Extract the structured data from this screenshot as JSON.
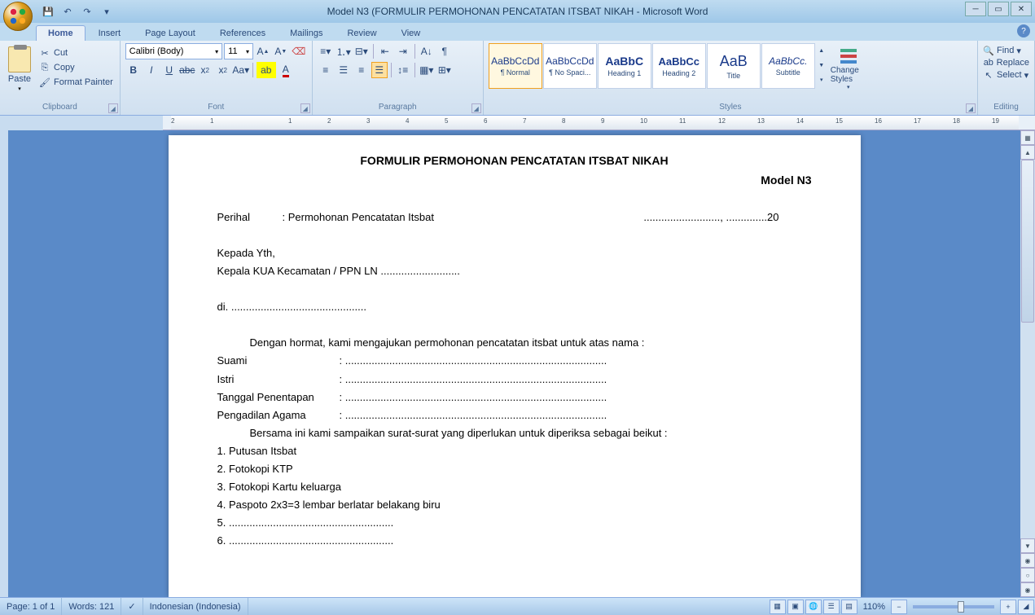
{
  "title": "Model N3 (FORMULIR PERMOHONAN PENCATATAN ITSBAT NIKAH - Microsoft Word",
  "qat": {
    "save": "💾",
    "undo": "↶",
    "redo": "↷"
  },
  "tabs": [
    "Home",
    "Insert",
    "Page Layout",
    "References",
    "Mailings",
    "Review",
    "View"
  ],
  "active_tab": 0,
  "clipboard": {
    "paste": "Paste",
    "cut": "Cut",
    "copy": "Copy",
    "format_painter": "Format Painter",
    "label": "Clipboard"
  },
  "font": {
    "name": "Calibri (Body)",
    "size": "11",
    "label": "Font"
  },
  "paragraph": {
    "label": "Paragraph"
  },
  "styles": {
    "items": [
      {
        "preview": "AaBbCcDd",
        "name": "¶ Normal"
      },
      {
        "preview": "AaBbCcDd",
        "name": "¶ No Spaci..."
      },
      {
        "preview": "AaBbC",
        "name": "Heading 1"
      },
      {
        "preview": "AaBbCc",
        "name": "Heading 2"
      },
      {
        "preview": "AaB",
        "name": "Title"
      },
      {
        "preview": "AaBbCc.",
        "name": "Subtitle"
      }
    ],
    "change": "Change Styles",
    "label": "Styles"
  },
  "editing": {
    "find": "Find",
    "replace": "Replace",
    "select": "Select",
    "label": "Editing"
  },
  "ruler_numbers": [
    "2",
    "1",
    "",
    "1",
    "2",
    "3",
    "4",
    "5",
    "6",
    "7",
    "8",
    "9",
    "10",
    "11",
    "12",
    "13",
    "14",
    "15",
    "16",
    "17",
    "18",
    "19"
  ],
  "document": {
    "heading": "FORMULIR PERMOHONAN PENCATATAN ITSBAT NIKAH",
    "model": "Model  N3",
    "perihal_label": "Perihal",
    "perihal_value": ": Permohonan Pencatatan Itsbat",
    "date_line": ".........................., ..............20",
    "kepada": "Kepada Yth,",
    "kepala": "Kepala KUA Kecamatan / PPN LN ...........................",
    "di": "di. ..............................................",
    "intro": "Dengan hormat, kami mengajukan permohonan pencatatan itsbat untuk atas nama :",
    "suami": "Suami",
    "istri": "Istri",
    "tanggal": "Tanggal Penentapan",
    "pengadilan": "Pengadilan Agama",
    "dots": ": .........................................................................................",
    "bersama": "Bersama ini kami sampaikan surat-surat yang diperlukan untuk diperiksa sebagai beikut :",
    "item1": "1.  Putusan Itsbat",
    "item2": "2.  Fotokopi  KTP",
    "item3": "3.  Fotokopi  Kartu keluarga",
    "item4": "4.  Paspoto 2x3=3 lembar berlatar belakang biru",
    "item5": "5.  ........................................................",
    "item6": "6.  ........................................................"
  },
  "status": {
    "page": "Page: 1 of 1",
    "words": "Words: 121",
    "lang": "Indonesian (Indonesia)",
    "zoom": "110%"
  }
}
